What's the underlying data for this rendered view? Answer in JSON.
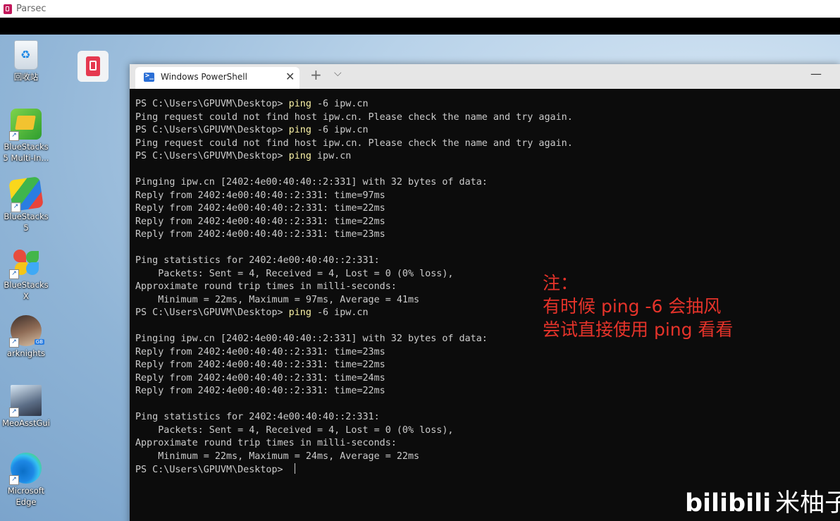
{
  "parsec": {
    "title": "Parsec"
  },
  "desktop": {
    "icons": [
      {
        "name": "recycle-bin",
        "label": "回收站"
      },
      {
        "name": "bluestacks-multi",
        "label": "BlueStacks 5 Multi-In..."
      },
      {
        "name": "bluestacks-5",
        "label": "BlueStacks 5"
      },
      {
        "name": "bluestacks-x",
        "label": "BlueStacks X"
      },
      {
        "name": "arknights",
        "label": "arknights"
      },
      {
        "name": "meoasstgui",
        "label": "MeoAsstGui"
      },
      {
        "name": "microsoft-edge",
        "label": "Microsoft Edge"
      }
    ]
  },
  "terminal": {
    "tab_title": "Windows PowerShell",
    "tab_close": "✕",
    "new_tab": "+",
    "tab_dropdown": "⌵",
    "minimize": "—",
    "lines": [
      {
        "prompt": "PS C:\\Users\\GPUVM\\Desktop> ",
        "cmd": "ping",
        "args": " -6 ipw.cn"
      },
      {
        "text": "Ping request could not find host ipw.cn. Please check the name and try again."
      },
      {
        "prompt": "PS C:\\Users\\GPUVM\\Desktop> ",
        "cmd": "ping",
        "args": " -6 ipw.cn"
      },
      {
        "text": "Ping request could not find host ipw.cn. Please check the name and try again."
      },
      {
        "prompt": "PS C:\\Users\\GPUVM\\Desktop> ",
        "cmd": "ping",
        "args": " ipw.cn"
      },
      {
        "text": ""
      },
      {
        "text": "Pinging ipw.cn [2402:4e00:40:40::2:331] with 32 bytes of data:"
      },
      {
        "text": "Reply from 2402:4e00:40:40::2:331: time=97ms"
      },
      {
        "text": "Reply from 2402:4e00:40:40::2:331: time=22ms"
      },
      {
        "text": "Reply from 2402:4e00:40:40::2:331: time=22ms"
      },
      {
        "text": "Reply from 2402:4e00:40:40::2:331: time=23ms"
      },
      {
        "text": ""
      },
      {
        "text": "Ping statistics for 2402:4e00:40:40::2:331:"
      },
      {
        "text": "    Packets: Sent = 4, Received = 4, Lost = 0 (0% loss),"
      },
      {
        "text": "Approximate round trip times in milli-seconds:"
      },
      {
        "text": "    Minimum = 22ms, Maximum = 97ms, Average = 41ms"
      },
      {
        "prompt": "PS C:\\Users\\GPUVM\\Desktop> ",
        "cmd": "ping",
        "args": " -6 ipw.cn"
      },
      {
        "text": ""
      },
      {
        "text": "Pinging ipw.cn [2402:4e00:40:40::2:331] with 32 bytes of data:"
      },
      {
        "text": "Reply from 2402:4e00:40:40::2:331: time=23ms"
      },
      {
        "text": "Reply from 2402:4e00:40:40::2:331: time=22ms"
      },
      {
        "text": "Reply from 2402:4e00:40:40::2:331: time=24ms"
      },
      {
        "text": "Reply from 2402:4e00:40:40::2:331: time=22ms"
      },
      {
        "text": ""
      },
      {
        "text": "Ping statistics for 2402:4e00:40:40::2:331:"
      },
      {
        "text": "    Packets: Sent = 4, Received = 4, Lost = 0 (0% loss),"
      },
      {
        "text": "Approximate round trip times in milli-seconds:"
      },
      {
        "text": "    Minimum = 22ms, Maximum = 24ms, Average = 22ms"
      },
      {
        "prompt": "PS C:\\Users\\GPUVM\\Desktop> ",
        "cmd": "",
        "args": "",
        "cursor": true
      }
    ]
  },
  "annotation": {
    "line1": "注：",
    "line2": "有时候 ping -6 会抽风",
    "line3": "尝试直接使用 ping 看看",
    "color": "#e5332a"
  },
  "watermark": {
    "logo": "bilibili",
    "author": "米柚子"
  },
  "colors": {
    "terminal_bg": "#0c0c0c",
    "terminal_text": "#cccccc",
    "command": "#f9f1a5"
  }
}
